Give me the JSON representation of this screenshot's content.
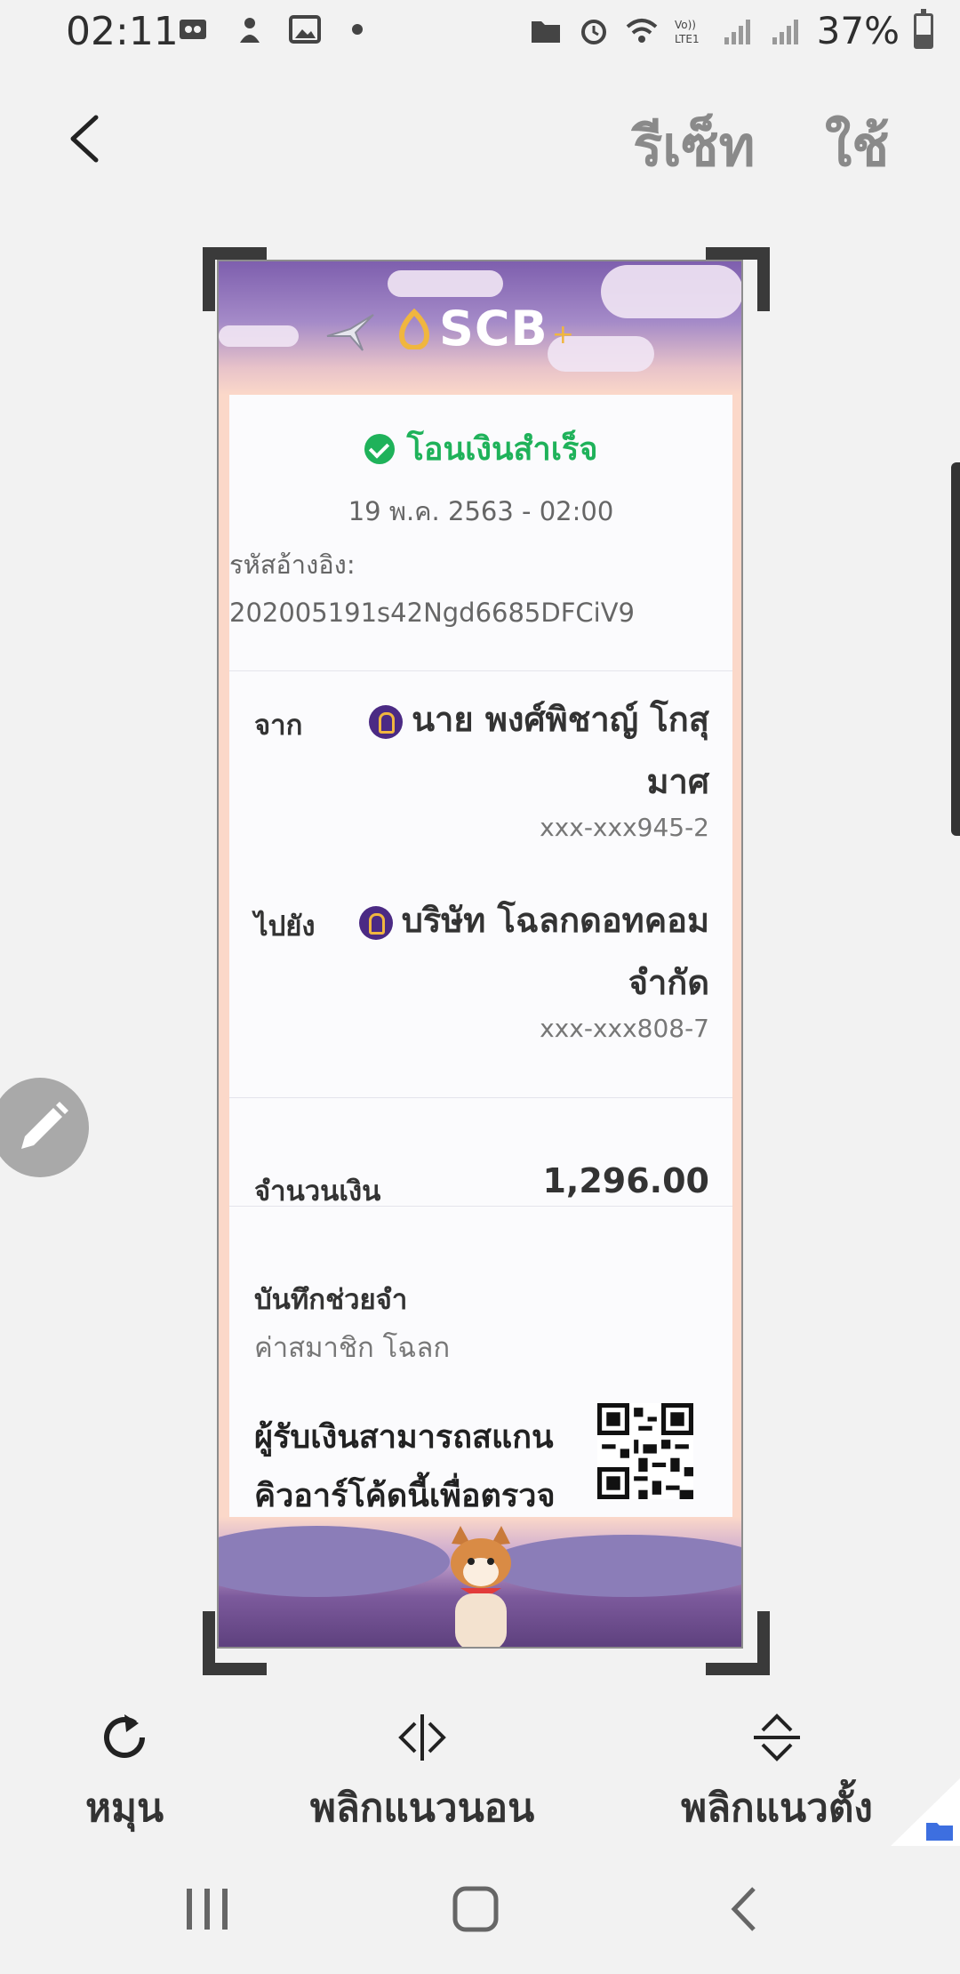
{
  "status_bar": {
    "time": "02:11",
    "battery_percent": "37%",
    "battery_level": 0.37,
    "network": "LTE1"
  },
  "toolbar": {
    "reset_label": "รีเซ็ท",
    "done_label": "ใช้"
  },
  "receipt": {
    "brand": "SCB",
    "status": "โอนเงินสำเร็จ",
    "datetime": "19 พ.ค. 2563 - 02:00",
    "ref_label": "รหัสอ้างอิง:",
    "ref_value": "202005191s42Ngd6685DFCiV9",
    "from_label": "จาก",
    "from_name": "นาย พงศ์พิชาญ์ โกสุมาศ",
    "from_account": "xxx-xxx945-2",
    "to_label": "ไปยัง",
    "to_name": "บริษัท โฉลกดอทคอม จำกัด",
    "to_account": "xxx-xxx808-7",
    "amount_label": "จำนวนเงิน",
    "amount_value": "1,296.00",
    "memo_label": "บันทึกช่วยจำ",
    "memo_value": "ค่าสมาชิก โฉลก",
    "qr_text": "ผู้รับเงินสามารถสแกนคิวอาร์โค้ดนี้เพื่อตรวจ"
  },
  "tools": {
    "rotate": "หมุน",
    "flip_horizontal": "พลิกแนวนอน",
    "flip_vertical": "พลิกแนวตั้ง"
  }
}
